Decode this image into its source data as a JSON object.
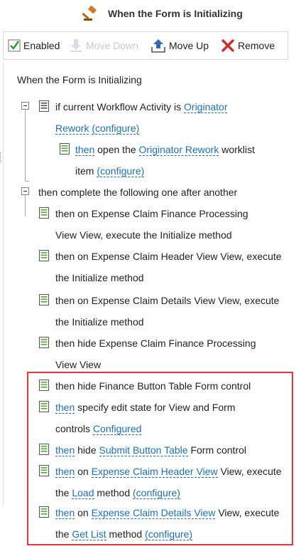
{
  "header": {
    "title": "When the Form is Initializing",
    "icon": "gavel-icon"
  },
  "toolbar": {
    "enabled": "Enabled",
    "move_down": "Move Down",
    "move_up": "Move Up",
    "remove": "Remove"
  },
  "rule": {
    "heading": "When the Form is Initializing",
    "cond": {
      "prefix": "if current Workflow Activity is",
      "link1": "Originator",
      "link2": "Rework",
      "configure": "(configure)"
    },
    "cond_action": {
      "then": "then",
      "text1": "open the",
      "link": "Originator Rework",
      "text2": "worklist",
      "text3": "item",
      "configure": "(configure)"
    },
    "group_label": "then complete the following one after another",
    "a1": {
      "l1": "then on Expense Claim Finance Processing",
      "l2": "View View, execute the Initialize method"
    },
    "a2": {
      "l1": "then on Expense Claim Header View View, execute",
      "l2": "the Initialize method"
    },
    "a3": {
      "l1": "then on Expense Claim Details View View, execute",
      "l2": "the Initialize method"
    },
    "a4": {
      "l1": "then hide Expense Claim Finance Processing",
      "l2": "View View"
    },
    "a5": {
      "text": "then hide Finance Button Table Form control"
    },
    "a6": {
      "then": "then",
      "text": "specify edit state for View and Form",
      "l2": "controls",
      "link": "Configured"
    },
    "a7": {
      "then": "then",
      "text1": "hide",
      "link": "Submit Button Table",
      "text2": "Form control"
    },
    "a8": {
      "then": "then",
      "text1": "on",
      "link": "Expense Claim Header View",
      "text2": "View, execute",
      "l2a": "the",
      "link2": "Load",
      "l2b": "method",
      "configure": "(configure)"
    },
    "a9": {
      "then": "then",
      "text1": "on",
      "link": "Expense Claim Details View",
      "text2": "View, execute",
      "l2a": "the",
      "link2": "Get List",
      "l2b": "method",
      "configure": "(configure)"
    }
  }
}
